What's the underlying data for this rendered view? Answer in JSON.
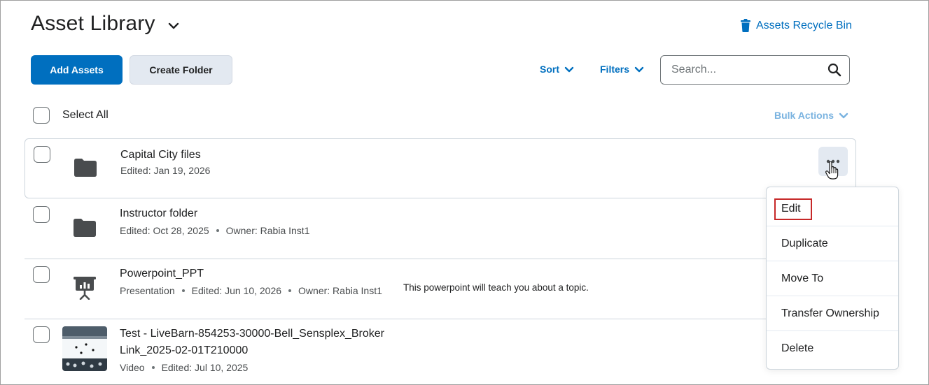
{
  "header": {
    "title": "Asset Library",
    "recycle_bin": "Assets Recycle Bin"
  },
  "toolbar": {
    "add_assets": "Add Assets",
    "create_folder": "Create Folder",
    "sort": "Sort",
    "filters": "Filters",
    "search_placeholder": "Search..."
  },
  "list": {
    "select_all": "Select All",
    "bulk_actions": "Bulk Actions",
    "items": [
      {
        "title": "Capital City files",
        "meta": [
          "Edited: Jan 19, 2026"
        ],
        "icon": "folder-icon"
      },
      {
        "title": "Instructor folder",
        "meta": [
          "Edited: Oct 28, 2025",
          "Owner: Rabia Inst1"
        ],
        "icon": "folder-icon"
      },
      {
        "title": "Powerpoint_PPT",
        "meta": [
          "Presentation",
          "Edited: Jun 10, 2026",
          "Owner: Rabia Inst1"
        ],
        "description": "This powerpoint will teach you about a topic.",
        "icon": "presentation-icon"
      },
      {
        "title_line1": "Test - LiveBarn-854253-30000-Bell_Sensplex_Broker",
        "title_line2": "Link_2025-02-01T210000",
        "meta": [
          "Video",
          "Edited: Jul 10, 2025"
        ],
        "icon": "video-thumbnail"
      }
    ]
  },
  "context_menu": {
    "items": [
      "Edit",
      "Duplicate",
      "Move To",
      "Transfer Ownership",
      "Delete"
    ]
  },
  "colors": {
    "primary": "#006fbf",
    "secondary_bg": "#e3e9f1",
    "highlight": "#c62828",
    "text": "#202122"
  }
}
